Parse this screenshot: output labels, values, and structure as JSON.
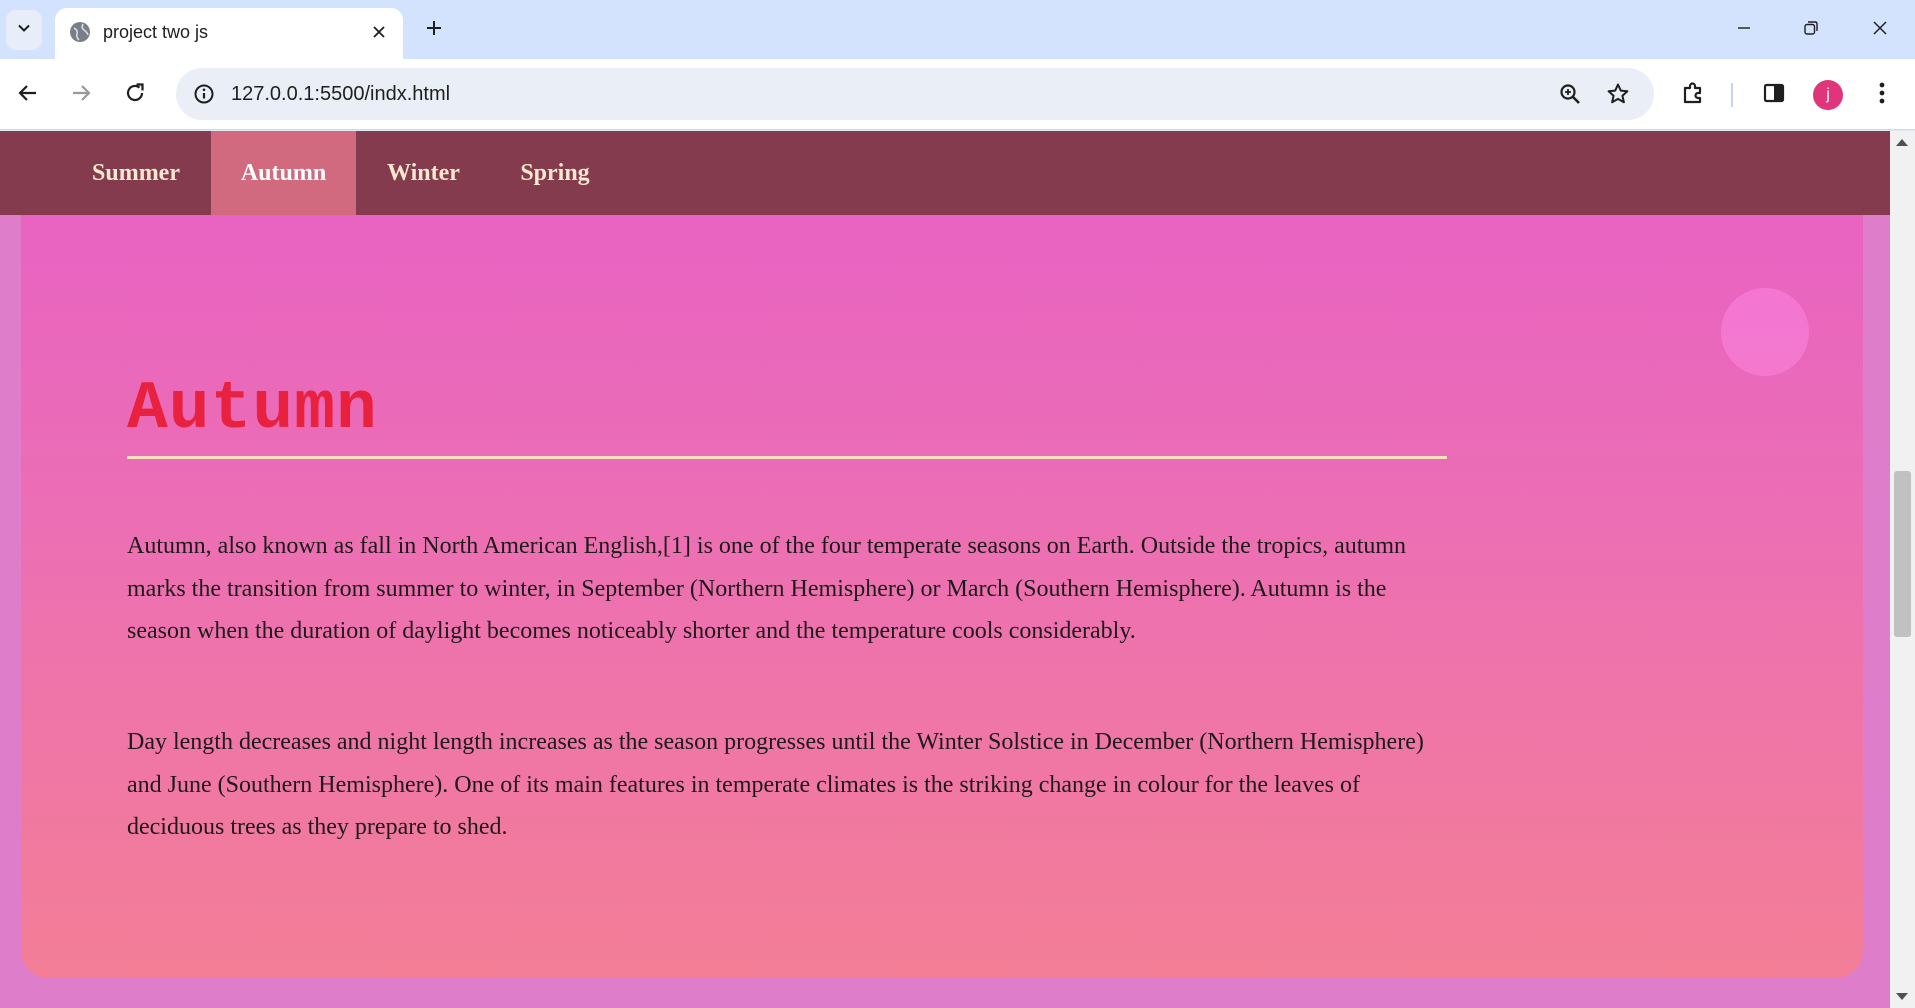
{
  "browser": {
    "tab_title": "project two js",
    "url": "127.0.0.1:5500/indx.html",
    "profile_initial": "j",
    "accent": "#e0357a"
  },
  "nav": {
    "items": [
      {
        "label": "Summer",
        "active": false
      },
      {
        "label": "Autumn",
        "active": true
      },
      {
        "label": "Winter",
        "active": false
      },
      {
        "label": "Spring",
        "active": false
      }
    ],
    "bar_color": "#853b4e",
    "active_color": "#d26a7f"
  },
  "section": {
    "title": "Autumn",
    "title_color": "#e8213e",
    "paragraphs": [
      "Autumn, also known as fall in North American English,[1] is one of the four temperate seasons on Earth. Outside the tropics, autumn marks the transition from summer to winter, in September (Northern Hemisphere) or March (Southern Hemisphere). Autumn is the season when the duration of daylight becomes noticeably shorter and the temperature cools considerably.",
      "Day length decreases and night length increases as the season progresses until the Winter Solstice in December (Northern Hemisphere) and June (Southern Hemisphere). One of its main features in temperate climates is the striking change in colour for the leaves of deciduous trees as they prepare to shed."
    ]
  }
}
